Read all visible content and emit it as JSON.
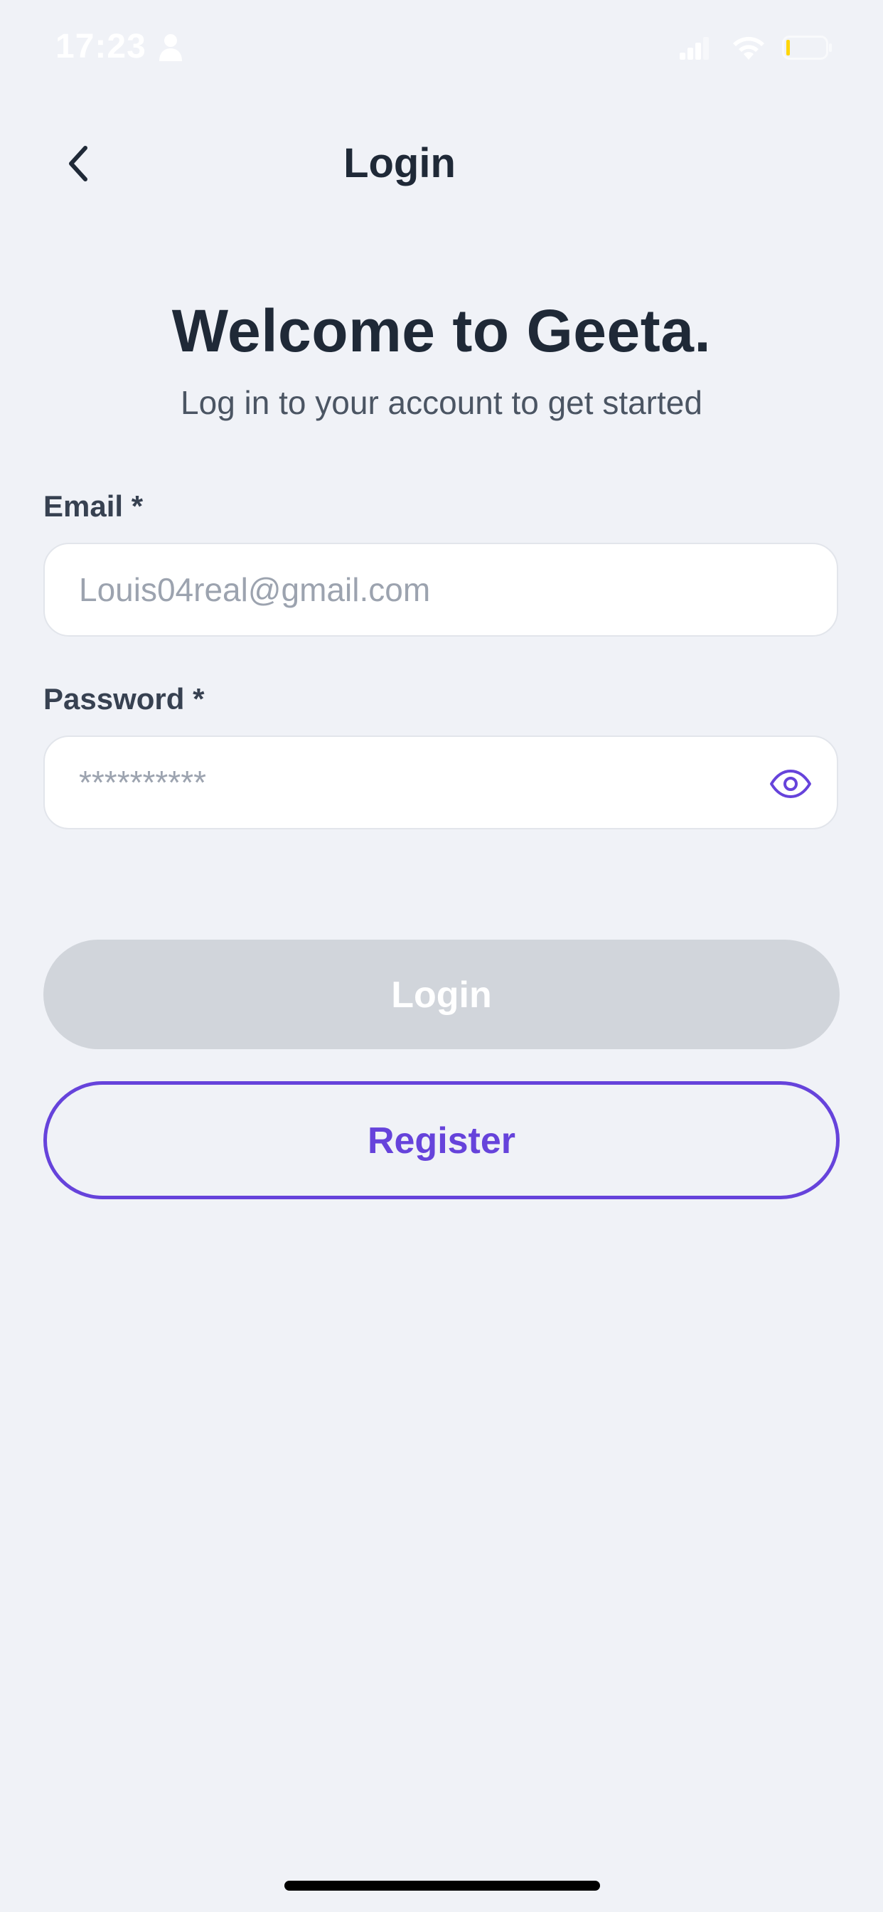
{
  "status_bar": {
    "time": "17:23",
    "icons": [
      "person-icon",
      "cellular-signal-icon",
      "wifi-icon",
      "battery-icon"
    ]
  },
  "header": {
    "title": "Login",
    "back_icon": "chevron-left-icon"
  },
  "welcome": {
    "title": "Welcome to Geeta.",
    "subtitle": "Log in to your account to get started"
  },
  "form": {
    "email_label": "Email *",
    "email_placeholder": "Louis04real@gmail.com",
    "password_label": "Password *",
    "password_placeholder": "**********",
    "password_toggle_icon": "eye-icon"
  },
  "actions": {
    "login_label": "Login",
    "register_label": "Register"
  },
  "colors": {
    "background": "#F0F2F7",
    "accent": "#6643DB",
    "disabled_button": "#D1D5DB",
    "heading": "#1F2937",
    "battery_level": "#FFD60A"
  }
}
